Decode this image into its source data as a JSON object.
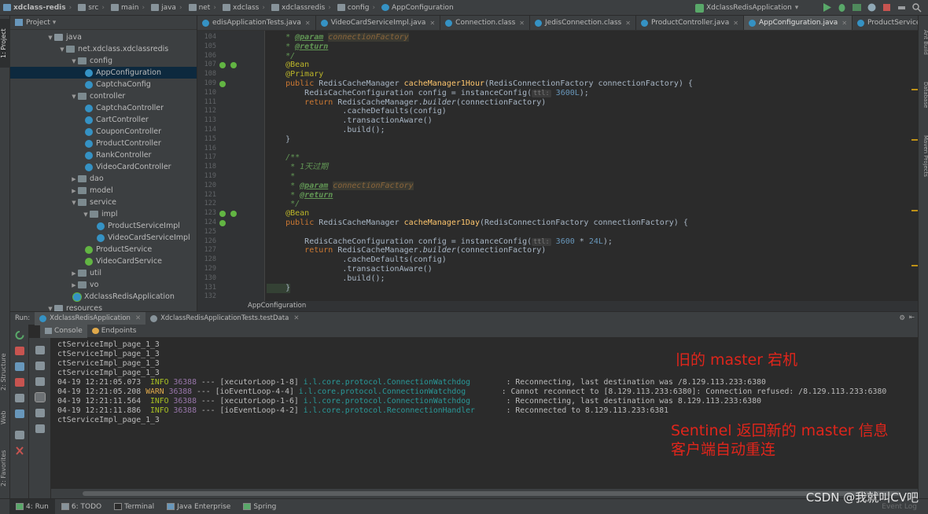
{
  "breadcrumbs": [
    "xdclass-redis",
    "src",
    "main",
    "java",
    "net",
    "xdclass",
    "xdclassredis",
    "config",
    "AppConfiguration"
  ],
  "run_config": "XdclassRedisApplication",
  "left_tool_tabs": [
    "1: Project",
    "2: Structure",
    "Web",
    "2: Favorites"
  ],
  "right_tool_tabs": [
    "Ant Build",
    "Database",
    "Maven Projects"
  ],
  "project": {
    "header": "Project",
    "tree": [
      {
        "label": "java",
        "type": "folder",
        "depth": 0,
        "expanded": true
      },
      {
        "label": "net.xdclass.xdclassredis",
        "type": "package",
        "depth": 1,
        "expanded": true
      },
      {
        "label": "config",
        "type": "package",
        "depth": 2,
        "expanded": true
      },
      {
        "label": "AppConfiguration",
        "type": "class",
        "depth": 3,
        "selected": true
      },
      {
        "label": "CaptchaConfig",
        "type": "class",
        "depth": 3
      },
      {
        "label": "controller",
        "type": "package",
        "depth": 2,
        "expanded": true
      },
      {
        "label": "CaptchaController",
        "type": "class",
        "depth": 3
      },
      {
        "label": "CartController",
        "type": "class",
        "depth": 3
      },
      {
        "label": "CouponController",
        "type": "class",
        "depth": 3
      },
      {
        "label": "ProductController",
        "type": "class",
        "depth": 3
      },
      {
        "label": "RankController",
        "type": "class",
        "depth": 3
      },
      {
        "label": "VideoCardController",
        "type": "class",
        "depth": 3
      },
      {
        "label": "dao",
        "type": "package",
        "depth": 2,
        "expanded": false
      },
      {
        "label": "model",
        "type": "package",
        "depth": 2,
        "expanded": false
      },
      {
        "label": "service",
        "type": "package",
        "depth": 2,
        "expanded": true
      },
      {
        "label": "impl",
        "type": "package",
        "depth": 3,
        "expanded": true
      },
      {
        "label": "ProductServiceImpl",
        "type": "class",
        "depth": 4
      },
      {
        "label": "VideoCardServiceImpl",
        "type": "class",
        "depth": 4
      },
      {
        "label": "ProductService",
        "type": "interface",
        "depth": 3
      },
      {
        "label": "VideoCardService",
        "type": "interface",
        "depth": 3
      },
      {
        "label": "util",
        "type": "package",
        "depth": 2,
        "expanded": false
      },
      {
        "label": "vo",
        "type": "package",
        "depth": 2,
        "expanded": false
      },
      {
        "label": "XdclassRedisApplication",
        "type": "app",
        "depth": 2
      },
      {
        "label": "resources",
        "type": "folder",
        "depth": 0,
        "expanded": true
      }
    ]
  },
  "editor_tabs": [
    {
      "label": "edisApplicationTests.java",
      "active": false
    },
    {
      "label": "VideoCardServiceImpl.java",
      "active": false
    },
    {
      "label": "Connection.class",
      "active": false
    },
    {
      "label": "JedisConnection.class",
      "active": false
    },
    {
      "label": "ProductController.java",
      "active": false
    },
    {
      "label": "AppConfiguration.java",
      "active": true
    },
    {
      "label": "ProductServiceImpl.java",
      "active": false
    }
  ],
  "editor": {
    "line_numbers": [
      "104",
      "105",
      "106",
      "107",
      "108",
      "109",
      "110",
      "111",
      "112",
      "113",
      "114",
      "115",
      "116",
      "117",
      "118",
      "119",
      "120",
      "121",
      "122",
      "123",
      "124",
      "125",
      "126",
      "127",
      "128",
      "129",
      "130",
      "131",
      "132"
    ],
    "code": {
      "l104": {
        "tag": "@param",
        "param": "connectionFactory"
      },
      "l105": {
        "tag": "@return"
      },
      "l106": "*/",
      "l107": "@Bean",
      "l108": "@Primary",
      "l109": {
        "kw": "public",
        "type": "RedisCacheManager",
        "fn": "cacheManager1Hour",
        "args": "(RedisConnectionFactory connectionFactory) {"
      },
      "l110": {
        "pre": "RedisCacheConfiguration config = instanceConfig(",
        "hint": "ttl:",
        "num": "3600L",
        "post": ");"
      },
      "l111": {
        "kw": "return",
        "pre": "RedisCacheManager.",
        "it": "builder",
        "post": "(connectionFactory)"
      },
      "l112": ".cacheDefaults(config)",
      "l113": ".transactionAware()",
      "l114": ".build();",
      "l115": "}",
      "l117": "/**",
      "l118": "* 1天过期",
      "l119": "*",
      "l120": {
        "tag": "@param",
        "param": "connectionFactory"
      },
      "l121": {
        "tag": "@return"
      },
      "l122": "*/",
      "l123": "@Bean",
      "l124": {
        "kw": "public",
        "type": "RedisCacheManager",
        "fn": "cacheManager1Day",
        "args": "(RedisConnectionFactory connectionFactory) {"
      },
      "l126": {
        "pre": "RedisCacheConfiguration config = instanceConfig(",
        "hint": "ttl:",
        "num1": "3600",
        "op": " * ",
        "num2": "24L",
        "post": ");"
      },
      "l127": {
        "kw": "return",
        "pre": "RedisCacheManager.",
        "it": "builder",
        "post": "(connectionFactory)"
      },
      "l128": ".cacheDefaults(config)",
      "l129": ".transactionAware()",
      "l130": ".build();",
      "l131": "}"
    },
    "footer": "AppConfiguration"
  },
  "run_panel": {
    "label": "Run:",
    "tabs": [
      "XdclassRedisApplication",
      "XdclassRedisApplicationTests.testData"
    ],
    "subtabs": [
      "Console",
      "Endpoints"
    ]
  },
  "console": {
    "plain_lines": [
      "ctServiceImpl_page_1_3",
      "ctServiceImpl_page_1_3",
      "ctServiceImpl_page_1_3",
      "ctServiceImpl_page_1_3"
    ],
    "log_lines": [
      {
        "ts": "04-19 12:21:05.073",
        "level": "INFO",
        "pid": "36388",
        "sep": "---",
        "thread": "[xecutorLoop-1-8]",
        "logger": "i.l.core.protocol.ConnectionWatchdog",
        "msg": ": Reconnecting, last destination was /8.129.113.233:6380"
      },
      {
        "ts": "04-19 12:21:05.208",
        "level": "WARN",
        "pid": "36388",
        "sep": "---",
        "thread": "[ioEventLoop-4-4]",
        "logger": "i.l.core.protocol.ConnectionWatchdog",
        "msg": ": Cannot reconnect to [8.129.113.233:6380]: Connection refused: /8.129.113.233:6380"
      },
      {
        "ts": "04-19 12:21:11.564",
        "level": "INFO",
        "pid": "36388",
        "sep": "---",
        "thread": "[xecutorLoop-1-6]",
        "logger": "i.l.core.protocol.ConnectionWatchdog",
        "msg": ": Reconnecting, last destination was 8.129.113.233:6380"
      },
      {
        "ts": "04-19 12:21:11.886",
        "level": "INFO",
        "pid": "36388",
        "sep": "---",
        "thread": "[ioEventLoop-4-2]",
        "logger": "i.l.core.protocol.ReconnectionHandler",
        "msg": ": Reconnected to 8.129.113.233:6381"
      }
    ],
    "last_line": "ctServiceImpl_page_1_3",
    "annotations": {
      "old_master_down": "旧的 master 宕机",
      "sentinel_line1": "Sentinel 返回新的 master 信息",
      "sentinel_line2": "客户端自动重连"
    }
  },
  "bottom_tabs": [
    {
      "label": "4: Run",
      "active": true
    },
    {
      "label": "6: TODO",
      "active": false
    },
    {
      "label": "Terminal",
      "active": false
    },
    {
      "label": "Java Enterprise",
      "active": false
    },
    {
      "label": "Spring",
      "active": false
    }
  ],
  "event_log": "Event Log",
  "watermark": "CSDN @我就叫CV吧",
  "colors": {
    "keyword": "#cc7832",
    "annotation": "#bbb529",
    "method": "#ffc66d",
    "number": "#6897bb",
    "doc_comment": "#629755",
    "info": "#a8c023",
    "warn": "#e0a94b",
    "logger": "#299999",
    "overlay_red": "#e0251b"
  }
}
